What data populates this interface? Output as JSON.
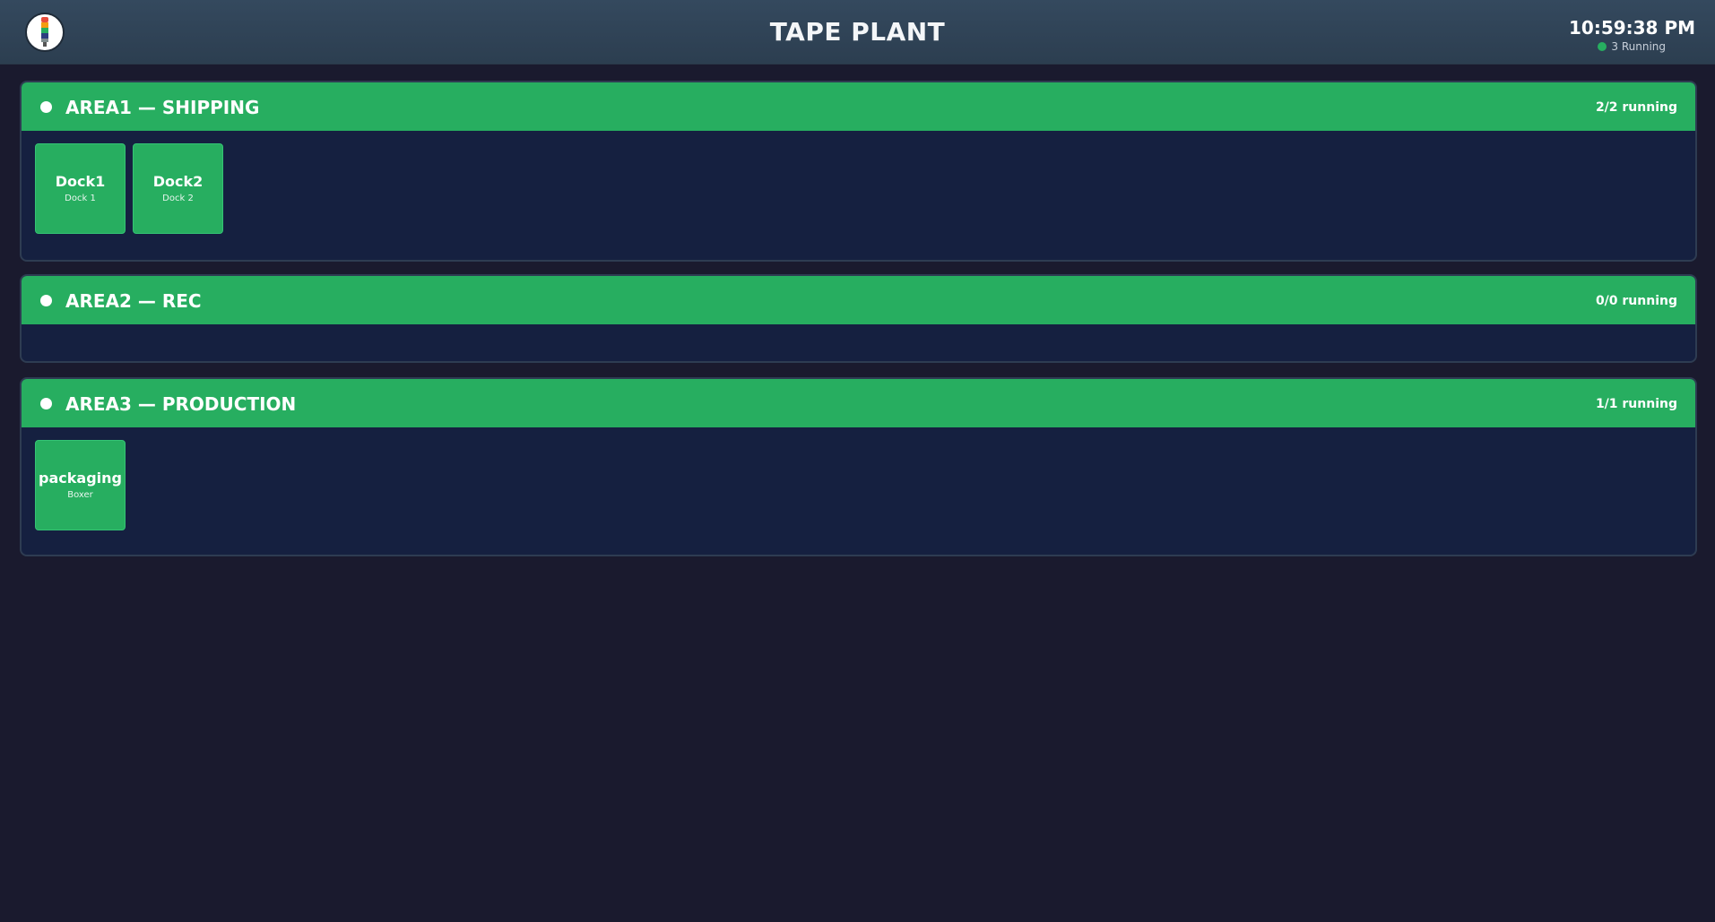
{
  "header": {
    "title": "TAPE PLANT",
    "clock": "10:59:38 PM",
    "status": "3 Running",
    "status_color": "#27ae60",
    "logo_icon": "stack-light-icon"
  },
  "colors": {
    "running": "#27ae60",
    "background": "#1a1a2e",
    "panel": "#152040"
  },
  "areas": [
    {
      "title": "AREA1 — SHIPPING",
      "count": "2/2 running",
      "tiles": [
        {
          "name": "Dock1",
          "sub": "Dock 1"
        },
        {
          "name": "Dock2",
          "sub": "Dock 2"
        }
      ]
    },
    {
      "title": "AREA2 — REC",
      "count": "0/0 running",
      "tiles": []
    },
    {
      "title": "AREA3 — PRODUCTION",
      "count": "1/1 running",
      "tiles": [
        {
          "name": "packaging",
          "sub": "Boxer"
        }
      ]
    }
  ]
}
